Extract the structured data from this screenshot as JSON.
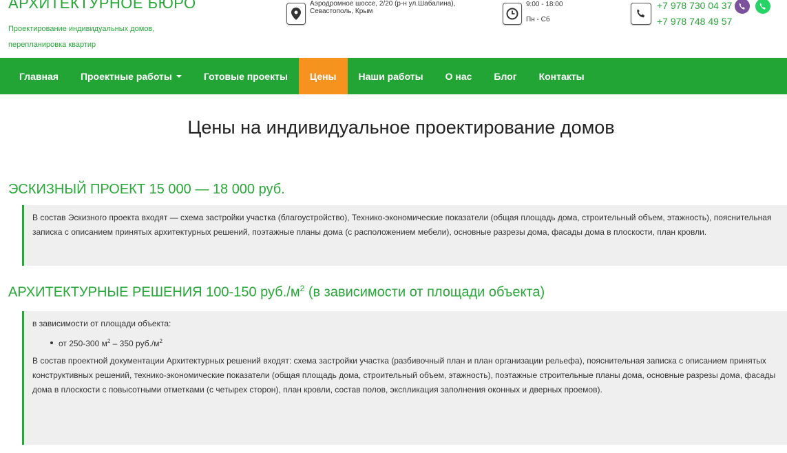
{
  "brand": {
    "title": "АРХИТЕКТУРНОЕ БЮРО",
    "subtitle_line1": "Проектирование индивидуальных домов,",
    "subtitle_line2": "перепланировка квартир"
  },
  "contact": {
    "address_line1": "Аэродромное шоссе, 2/20 (р-н ул.Шабалина),",
    "address_line2": "Севастополь, Крым",
    "hours_line1": "9:00 - 18:00",
    "hours_line2": "Пн - Сб",
    "phone1": "+7 978 730 04 37",
    "phone2": "+7 978 748 49 57",
    "icons": [
      "map-marker-icon",
      "clock-icon",
      "phone-icon",
      "viber-icon",
      "whatsapp-icon"
    ]
  },
  "nav": {
    "items": [
      {
        "label": "Главная"
      },
      {
        "label": "Проектные работы"
      },
      {
        "label": "Готовые проекты"
      },
      {
        "label": "Цены"
      },
      {
        "label": "Наши работы"
      },
      {
        "label": "О нас"
      },
      {
        "label": "Блог"
      },
      {
        "label": "Контакты"
      }
    ],
    "active": "Цены"
  },
  "main": {
    "title": "Цены на индивидуальное проектирование домов",
    "section1": {
      "heading": "ЭСКИЗНЫЙ ПРОЕКТ 15 000 — 18 000 руб.",
      "text": "В состав Эскизного проекта входят — схема застройки участка (благоустройство), Технико-экономические показатели (общая площадь дома, строительный объем, этажность), пояснительная записка с описанием принятых архитектурных решений, поэтажные планы дома (с расположением мебели), основные разрезы дома, фасады дома в плоскости, план кровли."
    },
    "section2": {
      "heading_pre": "АРХИТЕКТУРНЫЕ РЕШЕНИЯ 100-150 руб./м",
      "heading_sup": "2",
      "heading_post": " (в зависимости от площади объекта)",
      "intro": "в зависимости от площади объекта:",
      "bullet_a": "от 250-300 м",
      "bullet_sup1": "2",
      "bullet_b": " – 350 руб./м",
      "bullet_sup2": "2",
      "text": "В состав проектной документации Архитектурных решений входят: схема застройки участка (разбивочный план и план организации рельефа), пояснительная записка с описанием принятых конструктивных решений, технико-экономические показатели (общая площадь дома, строительный объем, этажность), поэтажные строительные планы дома, основные разрезы дома,  фасады дома в плоскости с повысотными отметками (с четырех сторон), план кровли, состав полов, экспликация заполнения оконных и дверных проемов)."
    }
  },
  "colors": {
    "brand_green": "#27a737",
    "nav_green": "#22a535",
    "active_orange": "#f6931e",
    "viber_purple": "#7b519d",
    "whatsapp_green": "#25d366"
  }
}
